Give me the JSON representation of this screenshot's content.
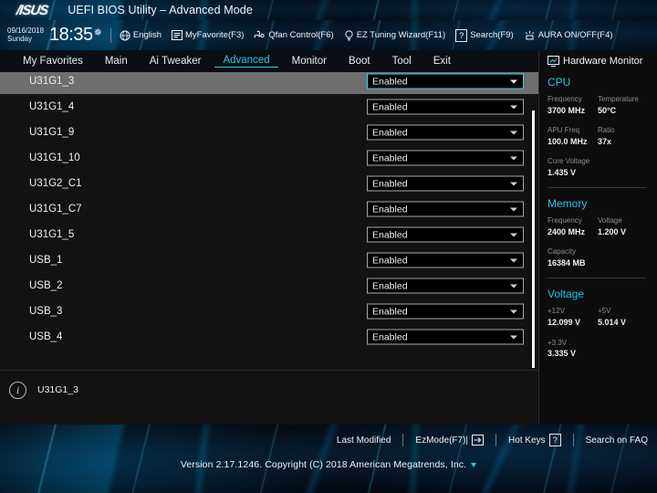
{
  "titlebar": {
    "brand": "/ISUS",
    "title": "UEFI BIOS Utility – Advanced Mode"
  },
  "infobar": {
    "date": "09/16/2018",
    "weekday": "Sunday",
    "time": "18:35",
    "gear_icon": "gear-icon",
    "items": [
      {
        "icon": "globe-icon",
        "label": "English"
      },
      {
        "icon": "star-list-icon",
        "label": "MyFavorite(F3)"
      },
      {
        "icon": "fan-icon",
        "label": "Qfan Control(F6)"
      },
      {
        "icon": "bulb-icon",
        "label": "EZ Tuning Wizard(F11)"
      },
      {
        "icon": "question-box-icon",
        "label": "Search(F9)"
      },
      {
        "icon": "aura-icon",
        "label": "AURA ON/OFF(F4)"
      }
    ]
  },
  "menu": {
    "tabs": [
      {
        "label": "My Favorites",
        "active": false
      },
      {
        "label": "Main",
        "active": false
      },
      {
        "label": "Ai Tweaker",
        "active": false
      },
      {
        "label": "Advanced",
        "active": true
      },
      {
        "label": "Monitor",
        "active": false
      },
      {
        "label": "Boot",
        "active": false
      },
      {
        "label": "Tool",
        "active": false
      },
      {
        "label": "Exit",
        "active": false
      }
    ],
    "active_color": "#2ec8e6"
  },
  "main": {
    "partial_row": {
      "label": "",
      "value": ""
    },
    "rows": [
      {
        "label": "U31G1_3",
        "value": "Enabled",
        "selected": true
      },
      {
        "label": "U31G1_4",
        "value": "Enabled",
        "selected": false
      },
      {
        "label": "U31G1_9",
        "value": "Enabled",
        "selected": false
      },
      {
        "label": "U31G1_10",
        "value": "Enabled",
        "selected": false
      },
      {
        "label": "U31G2_C1",
        "value": "Enabled",
        "selected": false
      },
      {
        "label": "U31G1_C7",
        "value": "Enabled",
        "selected": false
      },
      {
        "label": "U31G1_5",
        "value": "Enabled",
        "selected": false
      },
      {
        "label": "USB_1",
        "value": "Enabled",
        "selected": false
      },
      {
        "label": "USB_2",
        "value": "Enabled",
        "selected": false
      },
      {
        "label": "USB_3",
        "value": "Enabled",
        "selected": false
      },
      {
        "label": "USB_4",
        "value": "Enabled",
        "selected": false
      }
    ]
  },
  "help": {
    "icon": "info-icon",
    "text": "U31G1_3"
  },
  "sidebar": {
    "icon": "monitor-icon",
    "title": "Hardware Monitor",
    "sections": [
      {
        "name": "CPU",
        "pairs": [
          {
            "key": "Frequency",
            "value": "3700 MHz",
            "key2": "Temperature",
            "value2": "50°C"
          },
          {
            "key": "APU Freq",
            "value": "100.0 MHz",
            "key2": "Ratio",
            "value2": "37x"
          },
          {
            "key": "Core Voltage",
            "value": "1.435 V",
            "key2": "",
            "value2": ""
          }
        ]
      },
      {
        "name": "Memory",
        "pairs": [
          {
            "key": "Frequency",
            "value": "2400 MHz",
            "key2": "Voltage",
            "value2": "1.200 V"
          },
          {
            "key": "Capacity",
            "value": "16384 MB",
            "key2": "",
            "value2": ""
          }
        ]
      },
      {
        "name": "Voltage",
        "pairs": [
          {
            "key": "+12V",
            "value": "12.099 V",
            "key2": "+5V",
            "value2": "5.014 V"
          },
          {
            "key": "+3.3V",
            "value": "3.335 V",
            "key2": "",
            "value2": ""
          }
        ]
      }
    ],
    "accent": "#25c3e3"
  },
  "footer": {
    "links": [
      {
        "label": "Last Modified",
        "badge": ""
      },
      {
        "label": "EzMode(F7)|",
        "badge": "arrow-box-icon"
      },
      {
        "label": "Hot Keys",
        "badge": "?"
      },
      {
        "label": "Search on FAQ",
        "badge": ""
      }
    ],
    "version": "Version 2.17.1246. Copyright (C) 2018 American Megatrends, Inc."
  }
}
